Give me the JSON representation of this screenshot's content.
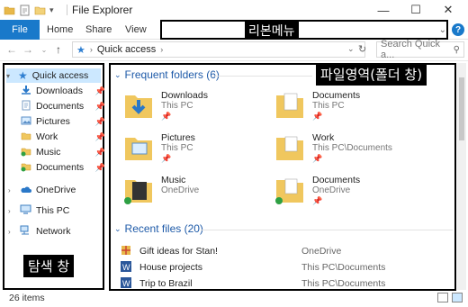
{
  "window": {
    "title": "File Explorer",
    "controls": [
      "minimize",
      "maximize",
      "close"
    ]
  },
  "ribbon": {
    "tabs": [
      {
        "label": "File",
        "active": true
      },
      {
        "label": "Home"
      },
      {
        "label": "Share"
      },
      {
        "label": "View"
      }
    ],
    "annotation": "리본메뉴"
  },
  "address": {
    "path_label": "Quick access",
    "search_placeholder": "Search Quick a..."
  },
  "nav": {
    "annotation": "탐색 창",
    "items": [
      {
        "label": "Quick access",
        "icon": "star-icon",
        "selected": true
      },
      {
        "label": "Downloads",
        "icon": "download-icon",
        "pinned": true
      },
      {
        "label": "Documents",
        "icon": "document-icon",
        "pinned": true
      },
      {
        "label": "Pictures",
        "icon": "pictures-icon",
        "pinned": true
      },
      {
        "label": "Work",
        "icon": "folder-icon",
        "pinned": true
      },
      {
        "label": "Music",
        "icon": "music-folder-icon",
        "pinned": true
      },
      {
        "label": "Documents",
        "icon": "folder-icon",
        "pinned": true
      },
      {
        "label": "OneDrive",
        "icon": "cloud-icon"
      },
      {
        "label": "This PC",
        "icon": "pc-icon"
      },
      {
        "label": "Network",
        "icon": "network-icon"
      }
    ]
  },
  "content": {
    "annotation": "파일영역(폴더 창)",
    "frequent_header": "Frequent folders (6)",
    "frequent": [
      {
        "name": "Downloads",
        "location": "This PC"
      },
      {
        "name": "Documents",
        "location": "This PC"
      },
      {
        "name": "Pictures",
        "location": "This PC"
      },
      {
        "name": "Work",
        "location": "This PC\\Documents"
      },
      {
        "name": "Music",
        "location": "OneDrive"
      },
      {
        "name": "Documents",
        "location": "OneDrive"
      }
    ],
    "recent_header": "Recent files (20)",
    "recent": [
      {
        "name": "Gift ideas for Stan!",
        "location": "OneDrive"
      },
      {
        "name": "House projects",
        "location": "This PC\\Documents"
      },
      {
        "name": "Trip to Brazil",
        "location": "This PC\\Documents"
      }
    ]
  },
  "status": {
    "item_count": "26 items"
  },
  "colors": {
    "accent": "#1979ca",
    "header_blue": "#1e5aa8",
    "selected_bg": "#cce8ff"
  }
}
